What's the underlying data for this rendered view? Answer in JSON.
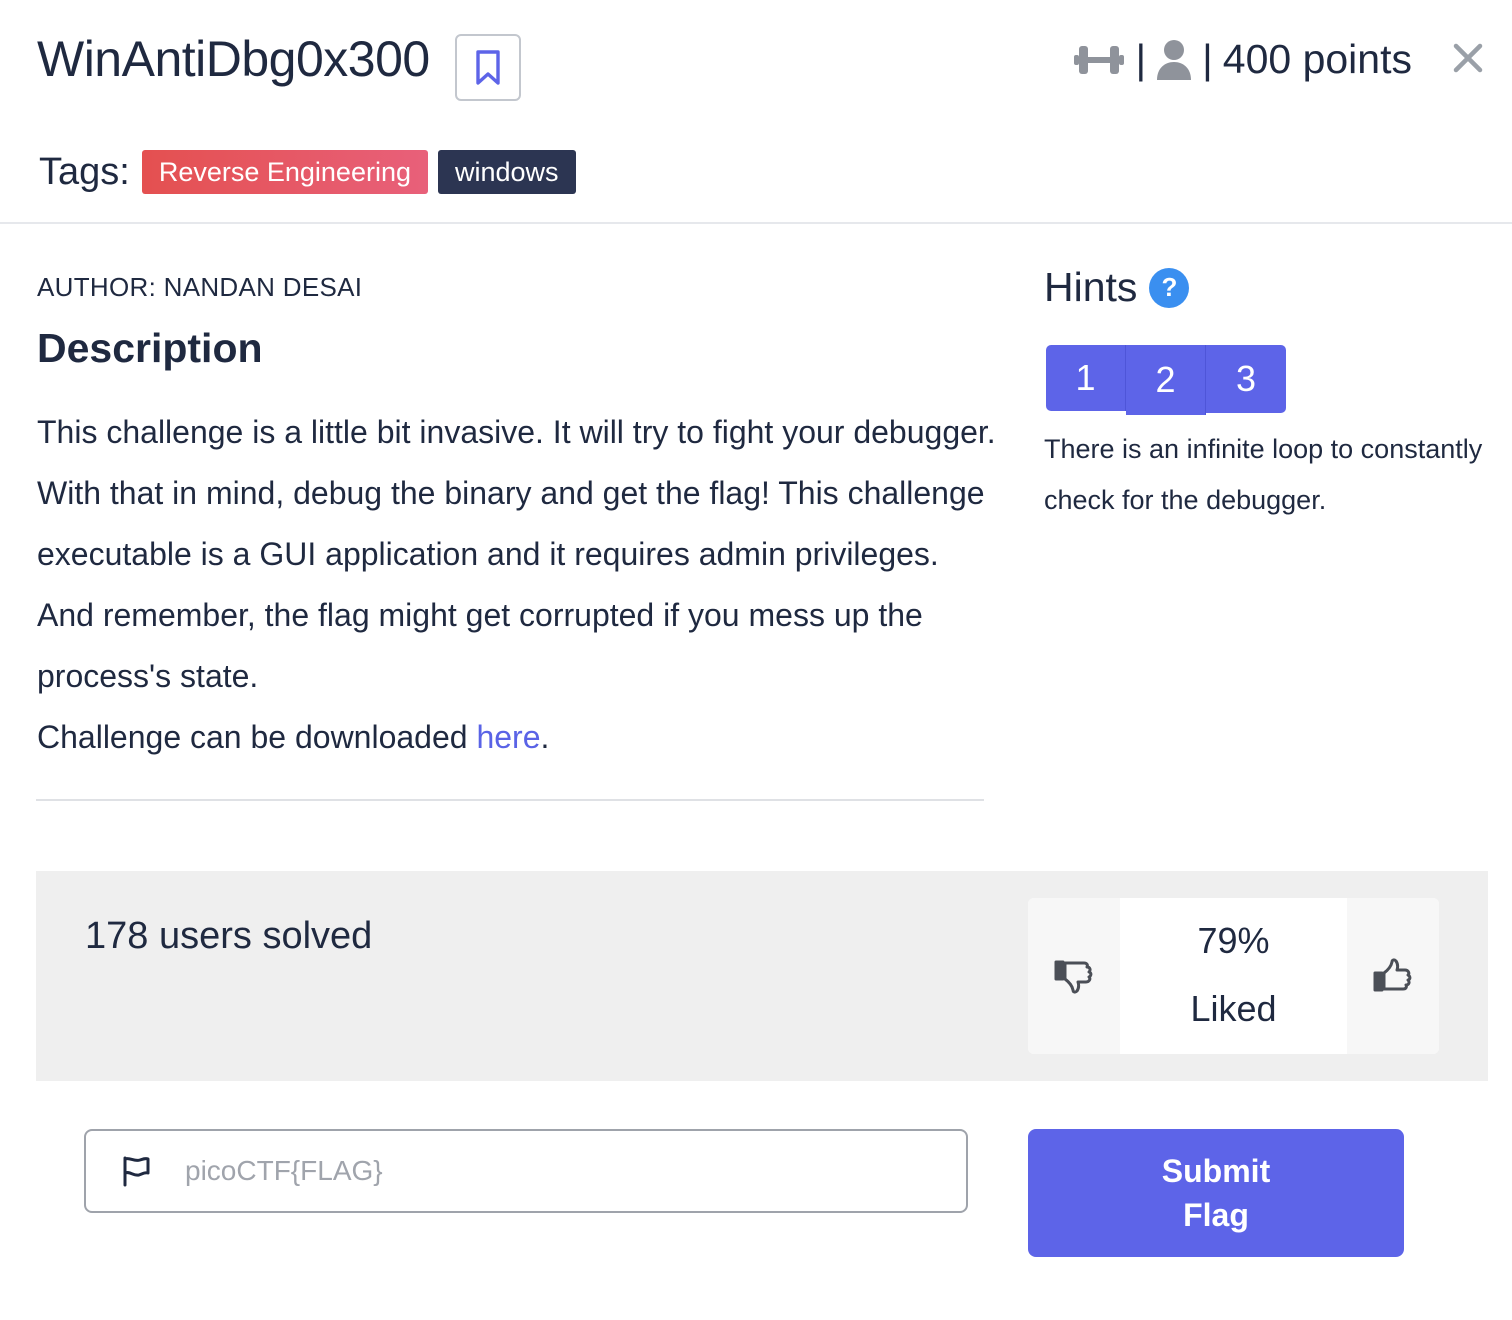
{
  "challenge": {
    "title": "WinAntiDbg0x300",
    "points": "400 points",
    "separator": "|",
    "tags_label": "Tags:",
    "tags": [
      "Reverse Engineering",
      "windows"
    ]
  },
  "description": {
    "author": "AUTHOR: NANDAN DESAI",
    "heading": "Description",
    "paragraph": "This challenge is a little bit invasive. It will try to fight your debugger. With that in mind, debug the binary and get the flag! This challenge executable is a GUI application and it requires admin privileges. And remember, the flag might get corrupted if you mess up the process's state.",
    "download_prefix": "Challenge can be downloaded ",
    "download_link": "here",
    "download_suffix": "."
  },
  "hints": {
    "heading": "Hints",
    "help_glyph": "?",
    "tabs": [
      "1",
      "2",
      "3"
    ],
    "active_text": "There is an infinite loop to constantly check for the debugger."
  },
  "stats": {
    "solved": "178 users solved",
    "liked_percent": "79%",
    "liked_label": "Liked"
  },
  "submit": {
    "placeholder": "picoCTF{FLAG}",
    "button_line1": "Submit",
    "button_line2": "Flag"
  },
  "icons": {
    "bookmark": "bookmark-icon",
    "difficulty": "dumbbell-icon",
    "user": "user-icon",
    "close": "close-icon",
    "help": "help-icon",
    "thumbs_down": "thumbs-down-icon",
    "thumbs_up": "thumbs-up-icon",
    "flag": "flag-icon"
  },
  "colors": {
    "primary": "#5d64e8",
    "tag_re": "#e45050",
    "tag_windows": "#2c3552",
    "link": "#5a63e6",
    "help": "#3a8ff0",
    "stats_bg": "#efefef"
  }
}
